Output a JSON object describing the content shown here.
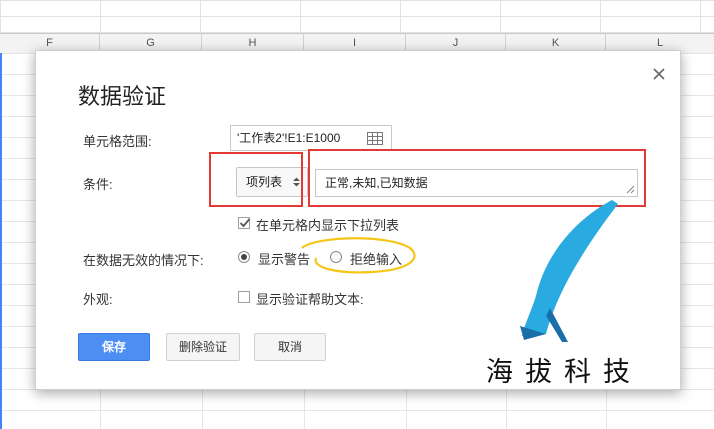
{
  "spreadsheet": {
    "columns": [
      "F",
      "G",
      "H",
      "I",
      "J",
      "K",
      "L"
    ]
  },
  "dialog": {
    "title": "数据验证",
    "range_label": "单元格范围:",
    "range_value": "'工作表2'!E1:E1000",
    "criteria_label": "条件:",
    "criteria_select": "项列表",
    "criteria_value": "正常,未知,已知数据",
    "dropdown_checkbox_label": "在单元格内显示下拉列表",
    "dropdown_checked": true,
    "invalid_label": "在数据无效的情况下:",
    "invalid_options": [
      {
        "label": "显示警告",
        "selected": true
      },
      {
        "label": "拒绝输入",
        "selected": false
      }
    ],
    "appearance_label": "外观:",
    "help_text_label": "显示验证帮助文本:",
    "help_text_checked": false,
    "buttons": {
      "save": "保存",
      "remove": "删除验证",
      "cancel": "取消"
    }
  },
  "watermark": {
    "text": "海拔科技",
    "accent_color": "#29abe2"
  },
  "colors": {
    "primary_button": "#4d8ef2",
    "annotation_red": "#e53935",
    "annotation_yellow": "#f5c518"
  }
}
